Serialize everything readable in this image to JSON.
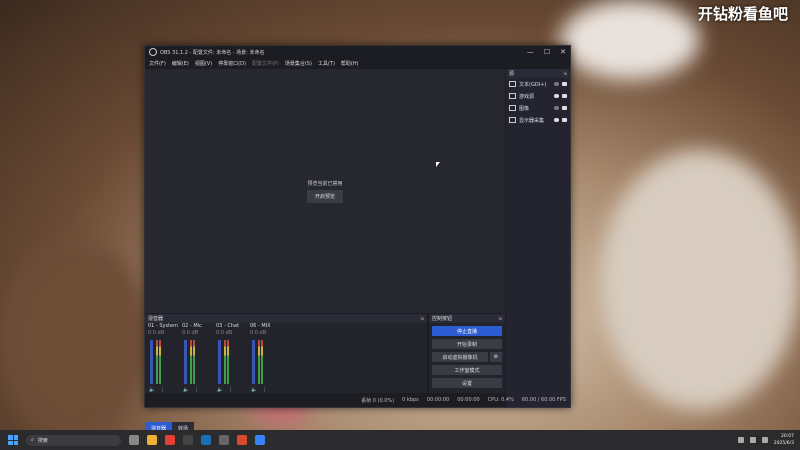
{
  "watermark": "开钻粉看鱼吧",
  "window": {
    "title": "OBS 31.1.2 - 配置文件: 未命名 - 场景: 未命名",
    "controls": [
      "—",
      "☐",
      "✕"
    ]
  },
  "menu": [
    {
      "label": "文件(F)",
      "disabled": false
    },
    {
      "label": "编辑(E)",
      "disabled": false
    },
    {
      "label": "视图(V)",
      "disabled": false
    },
    {
      "label": "停靠窗口(D)",
      "disabled": false
    },
    {
      "label": "配置文件(P)",
      "disabled": true
    },
    {
      "label": "场景集合(S)",
      "disabled": false
    },
    {
      "label": "工具(T)",
      "disabled": false
    },
    {
      "label": "帮助(H)",
      "disabled": false
    }
  ],
  "preview": {
    "message": "预览当前已禁用",
    "enable_button": "开启预览"
  },
  "sources": {
    "title": "源",
    "items": [
      {
        "name": "文本(GDI+)",
        "visible": false
      },
      {
        "name": "游戏源",
        "visible": true
      },
      {
        "name": "图像",
        "visible": false
      },
      {
        "name": "显示器采集",
        "visible": true
      }
    ]
  },
  "mixer": {
    "title": "混音器",
    "channels": [
      {
        "name": "01 - System",
        "db": "0.0 dB"
      },
      {
        "name": "02 - Mic",
        "db": "0.0 dB"
      },
      {
        "name": "03 - Chat",
        "db": "0.0 dB"
      },
      {
        "name": "06 - MIX",
        "db": "0.0 dB"
      }
    ],
    "ticks": [
      "0",
      "-5",
      "-10",
      "-15",
      "-20",
      "-25",
      "-30",
      "-35",
      "-40",
      "-45",
      "-50",
      "-55",
      "-60"
    ],
    "tabs": [
      "混音器",
      "转场"
    ]
  },
  "controls": {
    "title": "控制按钮",
    "stop_stream": "停止直播",
    "start_record": "开始录制",
    "start_virtual_cam": "启动虚拟摄像机",
    "studio_mode": "工作室模式",
    "settings": "设置"
  },
  "status": {
    "dropped": "丢帧 0 (0.0%)",
    "bitrate": "0 kbps",
    "stream_time": "00:00:00",
    "record_time": "00:00:00",
    "cpu": "CPU: 0.4%",
    "fps": "60.00 / 60.00 FPS"
  },
  "taskbar": {
    "search_placeholder": "搜索",
    "time": "20:07",
    "date": "2025/6/3"
  }
}
